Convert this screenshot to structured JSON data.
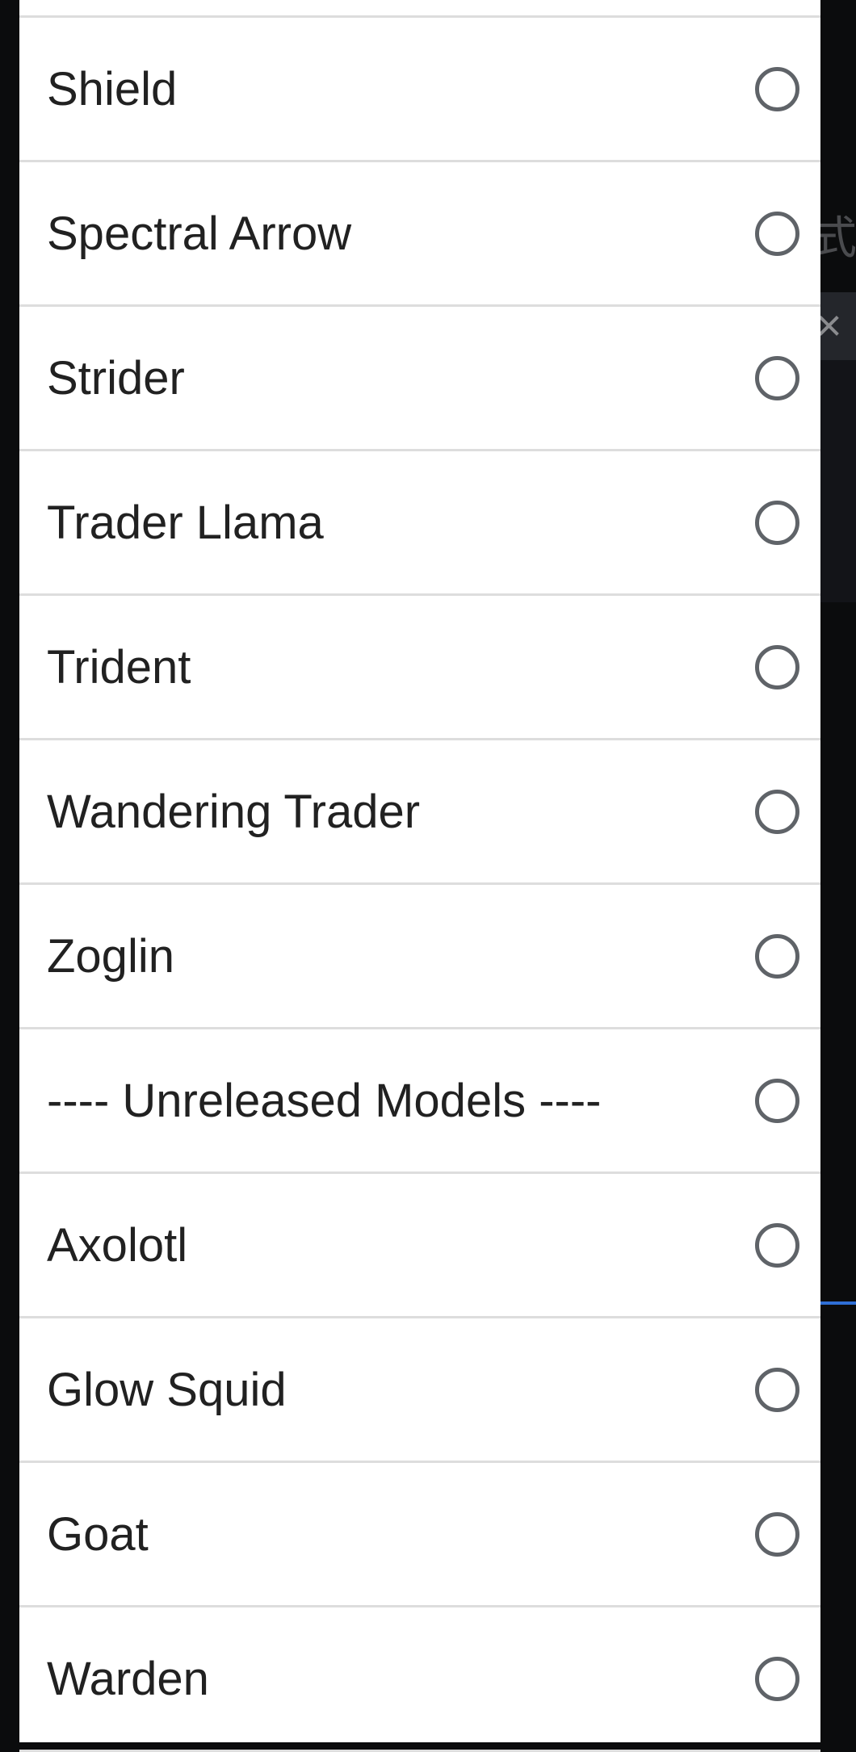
{
  "background": {
    "close_glyph": "×",
    "glyph": "式"
  },
  "options": [
    {
      "label": "Shield",
      "selected": false
    },
    {
      "label": "Spectral Arrow",
      "selected": false
    },
    {
      "label": "Strider",
      "selected": false
    },
    {
      "label": "Trader Llama",
      "selected": false
    },
    {
      "label": "Trident",
      "selected": false
    },
    {
      "label": "Wandering Trader",
      "selected": false
    },
    {
      "label": "Zoglin",
      "selected": false
    },
    {
      "label": "---- Unreleased Models ----",
      "selected": false
    },
    {
      "label": "Axolotl",
      "selected": false
    },
    {
      "label": "Glow Squid",
      "selected": false
    },
    {
      "label": "Goat",
      "selected": false
    },
    {
      "label": "Warden",
      "selected": false
    }
  ]
}
